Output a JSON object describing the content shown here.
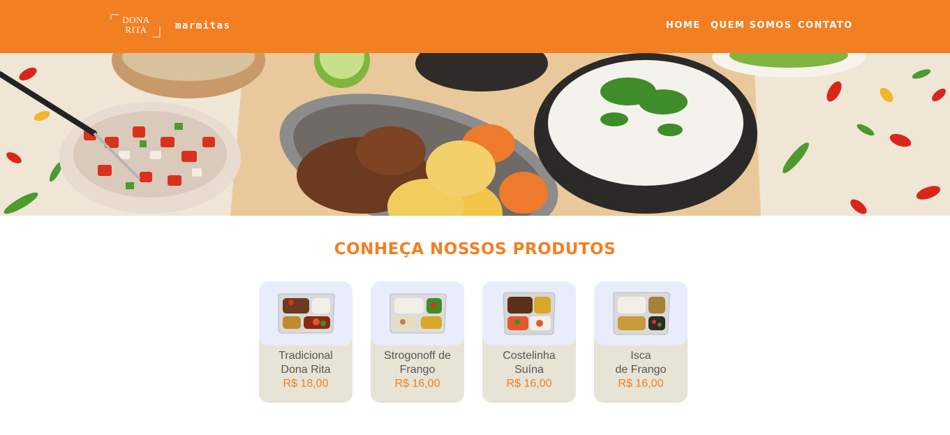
{
  "header": {
    "logo_line1": "DONA",
    "logo_line2": "RITA",
    "subtitle": "marmitas",
    "nav": [
      "HOME",
      "QUEM SOMOS",
      "CONTATO"
    ]
  },
  "hero": {
    "image": "food-spread-photo"
  },
  "products": {
    "title": "CONHEÇA NOSSOS PRODUTOS",
    "items": [
      {
        "name": "Tradicional\nDona Rita",
        "price": "R$ 18,00",
        "image": "marmita-tradicional"
      },
      {
        "name": "Strogonoff de\nFrango",
        "price": "R$ 16,00",
        "image": "marmita-strogonoff"
      },
      {
        "name": "Costelinha\nSuína",
        "price": "R$ 16,00",
        "image": "marmita-costelinha"
      },
      {
        "name": "Isca\nde Frango",
        "price": "R$ 16,00",
        "image": "marmita-isca"
      }
    ]
  },
  "colors": {
    "brand": "#f27f22",
    "card_bg": "#e7e3d5",
    "card_img_bg": "#e9ecfa",
    "text": "#555555"
  }
}
